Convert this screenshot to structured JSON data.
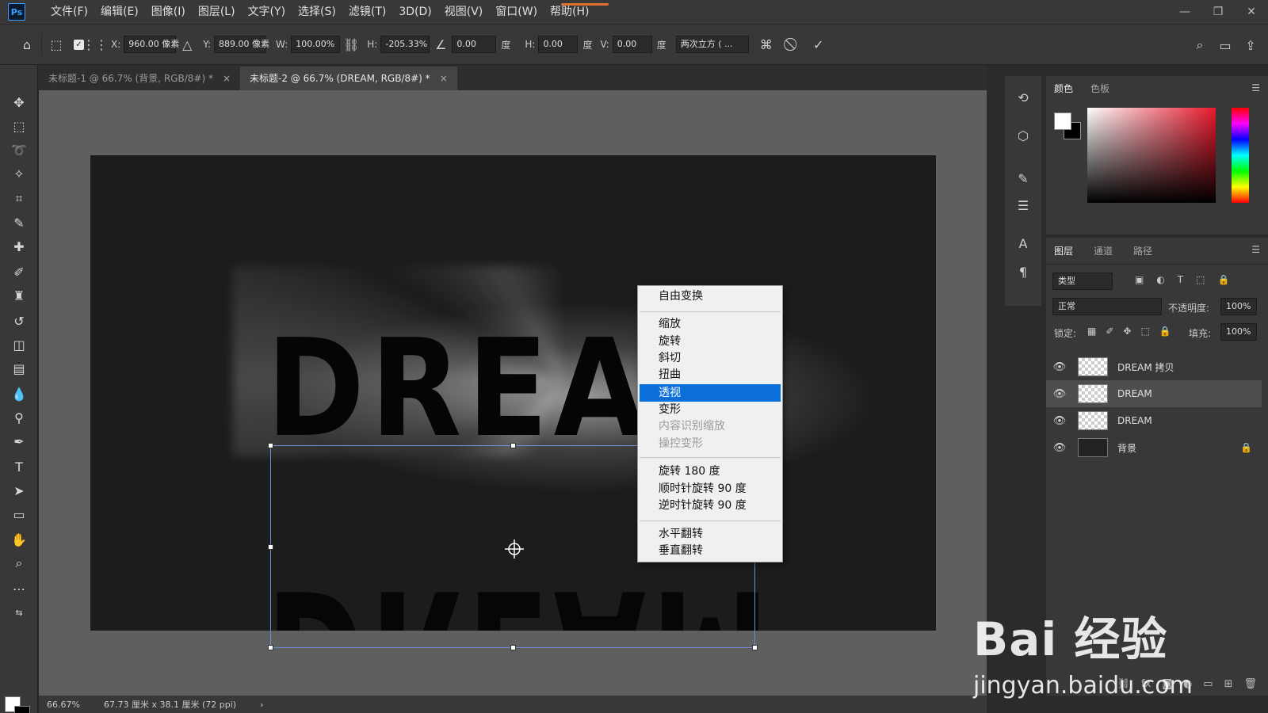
{
  "app": {
    "logo": "Ps"
  },
  "menubar": {
    "items": [
      "文件(F)",
      "编辑(E)",
      "图像(I)",
      "图层(L)",
      "文字(Y)",
      "选择(S)",
      "滤镜(T)",
      "3D(D)",
      "视图(V)",
      "窗口(W)",
      "帮助(H)"
    ],
    "accent_color": "#e07030"
  },
  "options": {
    "x_label": "X:",
    "x_value": "960.00 像素",
    "y_label": "Y:",
    "y_value": "889.00 像素",
    "w_label": "W:",
    "w_value": "100.00%",
    "h_label": "H:",
    "h_value": "-205.33%",
    "angle_value": "0.00",
    "angle_unit": "度",
    "hskew_label": "H:",
    "hskew_value": "0.00",
    "hskew_unit": "度",
    "vskew_label": "V:",
    "vskew_value": "0.00",
    "vskew_unit": "度",
    "interpolation": "两次立方 ( ..."
  },
  "tabs": [
    {
      "label": "未标题-1 @ 66.7% (背景, RGB/8#) *",
      "close": "×"
    },
    {
      "label": "未标题-2 @ 66.7% (DREAM, RGB/8#) *",
      "close": "×"
    }
  ],
  "canvas": {
    "text": "DREAM",
    "reflection_text": "DREAM"
  },
  "context_menu": {
    "items": [
      {
        "label": "自由变换",
        "state": "normal"
      },
      {
        "label": "缩放",
        "state": "normal"
      },
      {
        "label": "旋转",
        "state": "normal"
      },
      {
        "label": "斜切",
        "state": "normal"
      },
      {
        "label": "扭曲",
        "state": "normal"
      },
      {
        "label": "透视",
        "state": "selected"
      },
      {
        "label": "变形",
        "state": "normal"
      },
      {
        "label": "内容识别缩放",
        "state": "disabled"
      },
      {
        "label": "操控变形",
        "state": "disabled"
      },
      {
        "label": "旋转 180 度",
        "state": "normal"
      },
      {
        "label": "顺时针旋转 90 度",
        "state": "normal"
      },
      {
        "label": "逆时针旋转 90 度",
        "state": "normal"
      },
      {
        "label": "水平翻转",
        "state": "normal"
      },
      {
        "label": "垂直翻转",
        "state": "normal"
      }
    ],
    "selected_color": "#0a6fd8"
  },
  "color_panel": {
    "tabs": [
      "颜色",
      "色板"
    ],
    "fg_color": "#ffffff",
    "bg_color": "#000000"
  },
  "layers_panel": {
    "tabs": [
      "图层",
      "通道",
      "路径"
    ],
    "filter_placeholder": "类型",
    "blend_mode": "正常",
    "opacity_label": "不透明度:",
    "opacity_value": "100%",
    "lock_label": "锁定:",
    "fill_label": "填充:",
    "fill_value": "100%",
    "layers": [
      {
        "name": "DREAM 拷贝",
        "selected": false
      },
      {
        "name": "DREAM",
        "selected": true
      },
      {
        "name": "DREAM",
        "selected": false
      },
      {
        "name": "背景",
        "selected": false,
        "locked": true
      }
    ]
  },
  "status": {
    "zoom": "66.67%",
    "doc_info": "67.73 厘米 x 38.1 厘米 (72 ppi)"
  },
  "watermark": {
    "brand": "Bai  经验",
    "url": "jingyan.baidu.com"
  }
}
